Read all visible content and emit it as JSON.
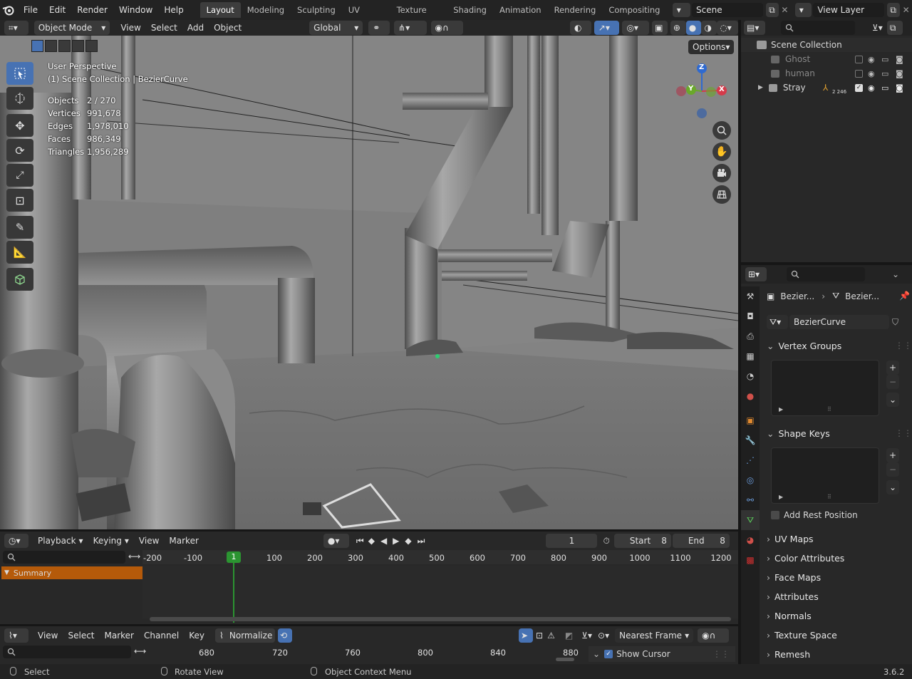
{
  "app": {
    "version": "3.6.2"
  },
  "menu": [
    "File",
    "Edit",
    "Render",
    "Window",
    "Help"
  ],
  "workspaces": [
    "Layout",
    "Modeling",
    "Sculpting",
    "UV Editing",
    "Texture Paint",
    "Shading",
    "Animation",
    "Rendering",
    "Compositing"
  ],
  "scene": {
    "name": "Scene",
    "view_layer": "View Layer"
  },
  "viewport_header": {
    "mode": "Object Mode",
    "menus": [
      "View",
      "Select",
      "Add",
      "Object"
    ],
    "transform": "Global",
    "options": "Options"
  },
  "viewport": {
    "perspective": "User Perspective",
    "collection": "(1) Scene Collection | BezierCurve",
    "stats": [
      {
        "label": "Objects",
        "value": "2 / 270"
      },
      {
        "label": "Vertices",
        "value": "991,678"
      },
      {
        "label": "Edges",
        "value": "1,978,010"
      },
      {
        "label": "Faces",
        "value": "986,349"
      },
      {
        "label": "Triangles",
        "value": "1,956,289"
      }
    ],
    "gizmo": {
      "x": "X",
      "y": "Y",
      "z": "Z"
    }
  },
  "outliner": {
    "root": "Scene Collection",
    "items": [
      {
        "name": "Ghost",
        "checked": false
      },
      {
        "name": "human",
        "checked": false
      },
      {
        "name": "Stray",
        "checked": true,
        "badge": "2 246"
      }
    ]
  },
  "properties": {
    "breadcrumb": [
      "Bezier...",
      "Bezier..."
    ],
    "data_name": "BezierCurve",
    "vertex_groups": "Vertex Groups",
    "shape_keys": "Shape Keys",
    "add_rest_position": "Add Rest Position",
    "collapsed_panels": [
      "UV Maps",
      "Color Attributes",
      "Face Maps",
      "Attributes",
      "Normals",
      "Texture Space",
      "Remesh"
    ]
  },
  "timeline": {
    "menus": [
      "Playback",
      "Keying",
      "View",
      "Marker"
    ],
    "current_frame": "1",
    "start_label": "Start",
    "start": "8",
    "end_label": "End",
    "end": "8",
    "ruler": [
      "-200",
      "-100",
      "1",
      "100",
      "200",
      "300",
      "400",
      "500",
      "600",
      "700",
      "800",
      "900",
      "1000",
      "1100",
      "1200"
    ],
    "summary": "Summary"
  },
  "graph_editor": {
    "menus": [
      "View",
      "Select",
      "Marker",
      "Channel",
      "Key"
    ],
    "normalize": "Normalize",
    "snap": "Nearest Frame",
    "ruler": [
      "680",
      "720",
      "760",
      "800",
      "840",
      "880"
    ],
    "show_cursor": "Show Cursor"
  },
  "status": {
    "select": "Select",
    "rotate": "Rotate View",
    "context": "Object Context Menu"
  },
  "colors": {
    "accent": "#4772b3",
    "summary": "#b55a0a",
    "frame_marker": "#2b9431"
  }
}
